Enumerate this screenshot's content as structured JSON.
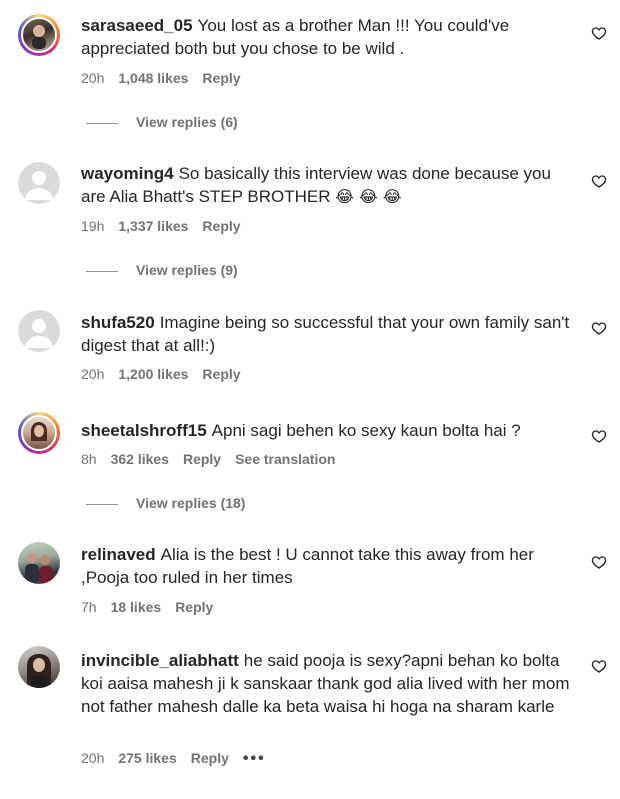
{
  "comments": [
    {
      "username": "sarasaeed_05",
      "text": "You lost as a brother Man !!! You could've appreciated both but you chose to be wild .",
      "time": "20h",
      "likes": "1,048 likes",
      "reply": "Reply",
      "view_replies": "View replies (6)"
    },
    {
      "username": "wayoming4",
      "text": "So basically this interview was done because you are Alia Bhatt's STEP BROTHER",
      "emoji": "😂 😂 😂",
      "time": "19h",
      "likes": "1,337 likes",
      "reply": "Reply",
      "view_replies": "View replies (9)"
    },
    {
      "username": "shufa520",
      "text": "Imagine being so successful that your own family san't digest that at all!:)",
      "time": "20h",
      "likes": "1,200 likes",
      "reply": "Reply"
    },
    {
      "username": "sheetalshroff15",
      "text": "Apni sagi behen ko sexy kaun bolta hai ?",
      "time": "8h",
      "likes": "362 likes",
      "reply": "Reply",
      "see_translation": "See translation",
      "view_replies": "View replies (18)"
    },
    {
      "username": "relinaved",
      "text": "Alia is the best ! U cannot take this away from her ,Pooja too ruled in her times",
      "time": "7h",
      "likes": "18 likes",
      "reply": "Reply"
    },
    {
      "username": "invincible_aliabhatt",
      "text": "he said pooja is sexy?apni behan ko bolta koi aaisa mahesh ji k sanskaar thank god alia lived with her mom not father mahesh dalle ka beta waisa hi hoga na sharam karle",
      "time": "20h",
      "likes": "275 likes",
      "reply": "Reply",
      "more": "•••"
    }
  ],
  "icons": {
    "heart": "heart-outline-icon",
    "default_avatar": "default-avatar-icon"
  },
  "colors": {
    "text": "#262626",
    "secondary": "#737373",
    "story_ring": "#d62976"
  }
}
